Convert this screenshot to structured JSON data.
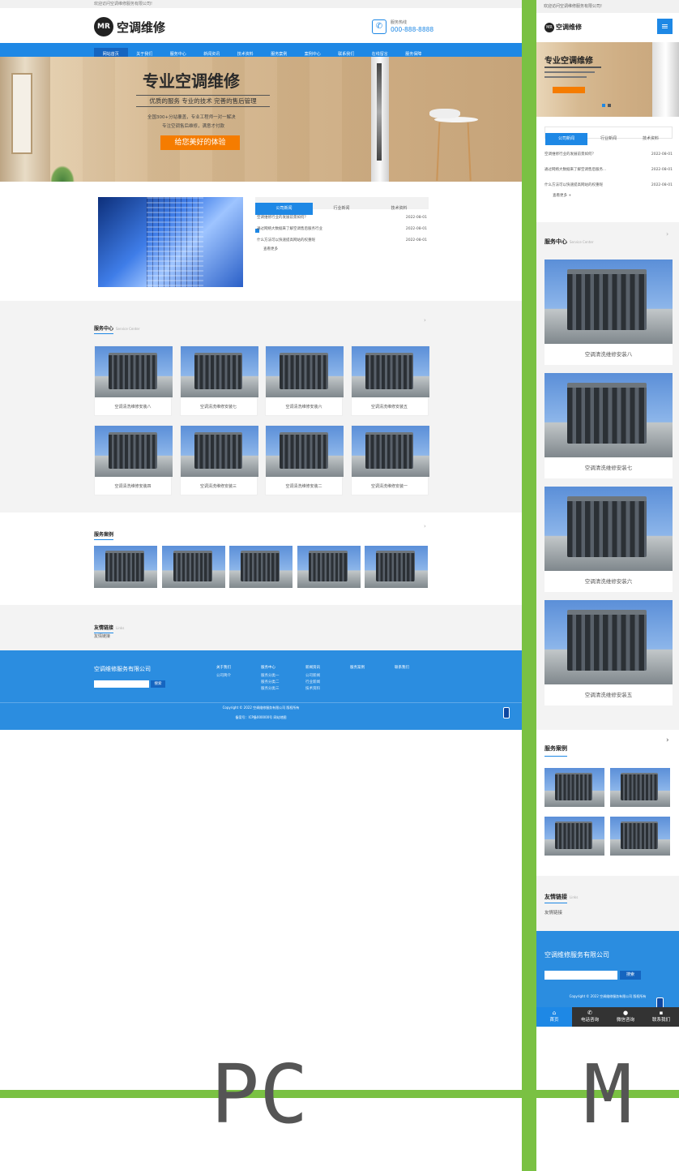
{
  "colors": {
    "primary": "#1e88e5",
    "accent": "#f57c00",
    "divider": "#7ac143"
  },
  "pc": {
    "top_text": "欢迎访问空调维修服务有限公司!",
    "logo_badge": "MR",
    "logo_text": "空调维修",
    "hotline_label": "服务热线",
    "hotline": "000-888-8888",
    "nav": [
      "网站首页",
      "关于我们",
      "服务中心",
      "新闻资讯",
      "技术资料",
      "服务案例",
      "案例中心",
      "联系我们",
      "在线留言",
      "服务保障"
    ],
    "banner": {
      "title": "专业空调维修",
      "subtitle": "优质的服务 专业的技术 完善的售后管理",
      "line1": "全国300+分站覆盖，专业工程师一对一解决",
      "line2": "专注空调售后维修，满意才付款",
      "button": "给您美好的体验"
    },
    "tabs": [
      "公司新闻",
      "行业新闻",
      "技术资料"
    ],
    "news": [
      {
        "title": "空调维修行业的发展前景如何？",
        "date": "2022-08-01"
      },
      {
        "title": "通过网络大数据来了解空调售后服务行业",
        "date": "2022-08-01"
      },
      {
        "title": "什么方法可以快速提高网站的权重呢",
        "date": "2022-08-01"
      }
    ],
    "more": "查看更多",
    "services_title": "服务中心",
    "services_sub": "Service Center",
    "services": [
      "空调清洗维修安装八",
      "空调清洗维修安装七",
      "空调清洗维修安装六",
      "空调清洗维修安装五",
      "空调清洗维修安装四",
      "空调清洗维修安装三",
      "空调清洗维修安装二",
      "空调清洗维修安装一"
    ],
    "cases_title": "服务案例",
    "links_title": "友情链接",
    "links_sub": "Links",
    "links_item": "友情链接",
    "footer": {
      "company": "空调维修服务有限公司",
      "search_btn": "搜索",
      "cols": [
        {
          "head": "关于我们",
          "items": [
            "公司简介"
          ]
        },
        {
          "head": "服务中心",
          "items": [
            "服务分类一",
            "服务分类二",
            "服务分类三"
          ]
        },
        {
          "head": "新闻资讯",
          "items": [
            "公司新闻",
            "行业新闻",
            "技术资料"
          ]
        },
        {
          "head": "服务案例",
          "items": []
        },
        {
          "head": "联系我们",
          "items": []
        }
      ],
      "copyright": "Copyright © 2022 空调维修服务有限公司 版权所有",
      "icp": "备案号：ICP备000000号 网站地图"
    }
  },
  "mobile": {
    "top_text": "欢迎访问空调维修服务有限公司!",
    "logo_badge": "MR",
    "logo_text": "空调维修",
    "banner_title": "专业空调维修",
    "tabs": [
      "公司新闻",
      "行业新闻",
      "技术资料"
    ],
    "news": [
      {
        "title": "空调维修行业的发展前景如何？",
        "date": "2022-08-01"
      },
      {
        "title": "通过网络大数据来了解空调售后服务...",
        "date": "2022-08-01"
      },
      {
        "title": "什么方法可以快速提高网站的权重呢",
        "date": "2022-08-01"
      }
    ],
    "more": "查看更多 +",
    "services_title": "服务中心",
    "services_sub": "Service Center",
    "services": [
      "空调清洗维修安装八",
      "空调清洗维修安装七",
      "空调清洗维修安装六",
      "空调清洗维修安装五"
    ],
    "cases_title": "服务案例",
    "links_title": "友情链接",
    "links_sub": "Links",
    "links_item": "友情链接",
    "footer_company": "空调维修服务有限公司",
    "search_btn": "搜索",
    "copyright": "Copyright © 2022 空调维修服务有限公司 版权所有",
    "bottom_nav": [
      "首页",
      "电话咨询",
      "微信咨询",
      "联系我们"
    ]
  },
  "labels": {
    "pc": "PC",
    "mobile": "M"
  }
}
